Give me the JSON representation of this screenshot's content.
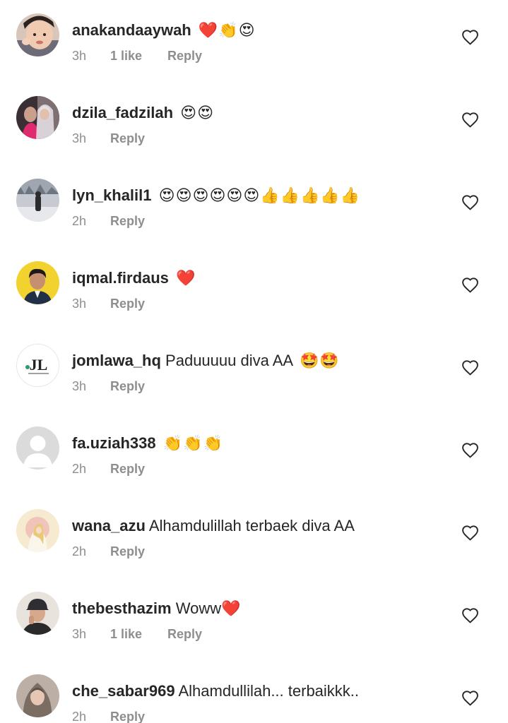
{
  "heart_icon_color": "#262626",
  "comments": [
    {
      "username": "anakandaaywah",
      "text": "",
      "emojis": "❤️👏😍",
      "time": "3h",
      "likes": "1 like",
      "reply": "Reply"
    },
    {
      "username": "dzila_fadzilah",
      "text": "",
      "emojis": "😍😍",
      "time": "3h",
      "likes": "",
      "reply": "Reply"
    },
    {
      "username": "lyn_khalil1",
      "text": "",
      "emojis": "😍😍😍😍😍😍👍👍👍👍👍",
      "time": "2h",
      "likes": "",
      "reply": "Reply"
    },
    {
      "username": "iqmal.firdaus",
      "text": "",
      "emojis": "❤️",
      "time": "3h",
      "likes": "",
      "reply": "Reply"
    },
    {
      "username": "jomlawa_hq",
      "text": "Paduuuuu diva AA",
      "emojis": "🤩🤩",
      "time": "3h",
      "likes": "",
      "reply": "Reply"
    },
    {
      "username": "fa.uziah338",
      "text": "",
      "emojis": "👏👏👏",
      "time": "2h",
      "likes": "",
      "reply": "Reply"
    },
    {
      "username": "wana_azu",
      "text": "Alhamdulillah terbaek diva AA",
      "emojis": "",
      "time": "2h",
      "likes": "",
      "reply": "Reply"
    },
    {
      "username": "thebesthazim",
      "text": "Woww",
      "emojis": "❤️",
      "time": "3h",
      "likes": "1 like",
      "reply": "Reply"
    },
    {
      "username": "che_sabar969",
      "text": "Alhamdullilah... terbaikkk..",
      "emojis": "",
      "time": "2h",
      "likes": "",
      "reply": "Reply"
    }
  ],
  "avatars": [
    {
      "name": "child-photo",
      "bg": "#d9c9c0"
    },
    {
      "name": "couple-photo",
      "bg": "#3a2f36"
    },
    {
      "name": "snow-photo",
      "bg": "#c9ccd1"
    },
    {
      "name": "man-yellow-photo",
      "bg": "#f2d22e"
    },
    {
      "name": "jl-logo",
      "bg": "#ffffff"
    },
    {
      "name": "default-avatar",
      "bg": "#dbdbdb"
    },
    {
      "name": "illustration-photo",
      "bg": "#f4e7c8"
    },
    {
      "name": "man-cap-photo",
      "bg": "#e8e2dc"
    },
    {
      "name": "hijab-photo",
      "bg": "#b9ada3"
    }
  ],
  "jl_logo_text": "JL"
}
